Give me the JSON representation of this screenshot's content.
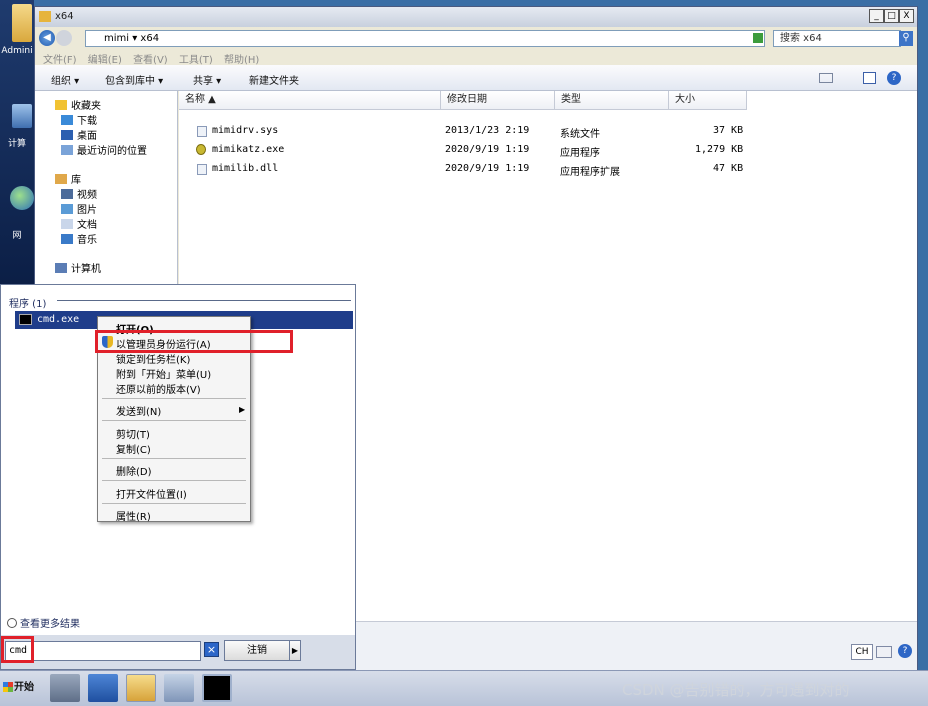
{
  "desktop": {
    "labels": [
      "Admini",
      "计算",
      "网"
    ]
  },
  "window": {
    "title": "x64",
    "address": "mimi ▾ x64",
    "search_placeholder": "搜索 x64",
    "buttons": {
      "minimize": "_",
      "maximize": "□",
      "close": "X"
    }
  },
  "menu_bar": [
    "文件(F)",
    "编辑(E)",
    "查看(V)",
    "工具(T)",
    "帮助(H)"
  ],
  "toolbar": {
    "organize": "组织 ▾",
    "include_in_library": "包含到库中 ▾",
    "share": "共享 ▾",
    "new_folder": "新建文件夹"
  },
  "nav": {
    "favorites": "收藏夹",
    "downloads": "下载",
    "desktop": "桌面",
    "recent": "最近访问的位置",
    "libraries": "库",
    "videos": "视频",
    "pictures": "图片",
    "documents": "文档",
    "music": "音乐",
    "computer": "计算机"
  },
  "columns": {
    "name": "名称",
    "date": "修改日期",
    "type": "类型",
    "size": "大小"
  },
  "files": [
    {
      "name": "mimidrv.sys",
      "date": "2013/1/23 2:19",
      "type": "系统文件",
      "size": "37 KB"
    },
    {
      "name": "mimikatz.exe",
      "date": "2020/9/19 1:19",
      "type": "应用程序",
      "size": "1,279 KB"
    },
    {
      "name": "mimilib.dll",
      "date": "2020/9/19 1:19",
      "type": "应用程序扩展",
      "size": "47 KB"
    }
  ],
  "start_menu": {
    "programs_header": "程序 (1)",
    "program_item": "cmd.exe",
    "see_more": "查看更多结果",
    "search_value": "cmd",
    "clear_label": "×",
    "logoff_label": "注销",
    "logoff_arrow": "▶"
  },
  "context_menu": {
    "open": "打开(O)",
    "run_as_admin": "以管理员身份运行(A)",
    "pin_taskbar": "锁定到任务栏(K)",
    "pin_start": "附到「开始」菜单(U)",
    "restore_versions": "还原以前的版本(V)",
    "send_to": "发送到(N)",
    "cut": "剪切(T)",
    "copy": "复制(C)",
    "delete": "删除(D)",
    "open_location": "打开文件位置(I)",
    "properties": "属性(R)"
  },
  "taskbar": {
    "start_label": "开始",
    "tray_lang": "CH",
    "watermark": "CSDN @告别错的，方可遇到对的"
  },
  "colors": {
    "highlight_red": "#e0202a",
    "selection_blue": "#1f3d8a"
  }
}
